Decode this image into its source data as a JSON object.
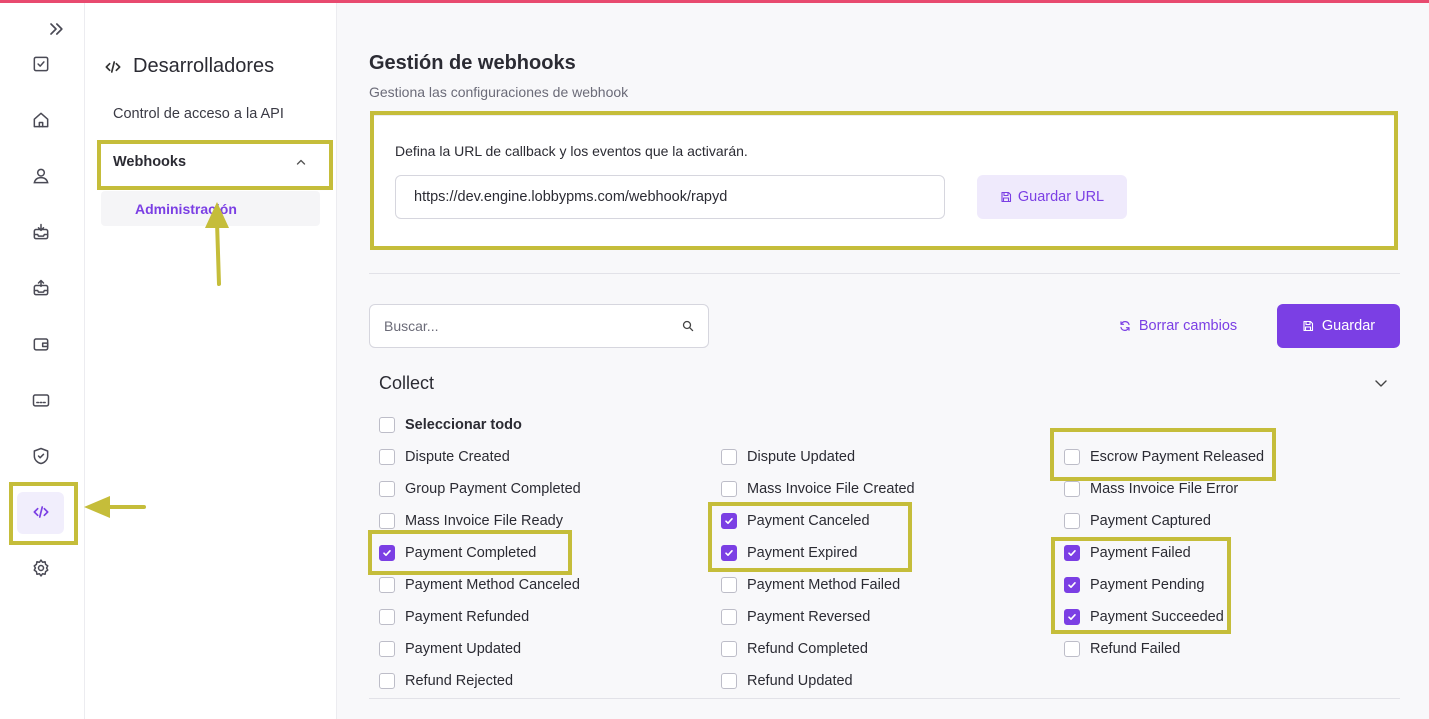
{
  "colors": {
    "accent": "#7b3fe4",
    "top_bar": "#e84a6f",
    "annotation": "#c5bd3a"
  },
  "rail": {
    "icons": [
      "chevrons-right-icon",
      "checkbox-icon",
      "home-icon",
      "user-icon",
      "inbox-in-icon",
      "inbox-out-icon",
      "wallet-icon",
      "card-icon",
      "shield-check-icon",
      "code-icon",
      "gear-icon"
    ],
    "active": "code-icon"
  },
  "subnav": {
    "title": "Desarrolladores",
    "link": "Control de acceso a la API",
    "group": "Webhooks",
    "child": "Administración"
  },
  "main": {
    "title": "Gestión de webhooks",
    "subtitle": "Gestiona las configuraciones de webhook",
    "url_card": {
      "label": "Defina la URL de callback y los eventos que la activarán.",
      "url_value": "https://dev.engine.lobbypms.com/webhook/rapyd",
      "save_url_label": "Guardar URL"
    },
    "search_placeholder": "Buscar...",
    "reset_label": "Borrar cambios",
    "save_label": "Guardar",
    "section": "Collect",
    "select_all": "Seleccionar todo",
    "events": [
      [
        {
          "label": "Dispute Created",
          "checked": false
        },
        {
          "label": "Dispute Updated",
          "checked": false
        },
        {
          "label": "Escrow Payment Released",
          "checked": false
        }
      ],
      [
        {
          "label": "Group Payment Completed",
          "checked": false
        },
        {
          "label": "Mass Invoice File Created",
          "checked": false
        },
        {
          "label": "Mass Invoice File Error",
          "checked": false
        }
      ],
      [
        {
          "label": "Mass Invoice File Ready",
          "checked": false
        },
        {
          "label": "Payment Canceled",
          "checked": true
        },
        {
          "label": "Payment Captured",
          "checked": false
        }
      ],
      [
        {
          "label": "Payment Completed",
          "checked": true
        },
        {
          "label": "Payment Expired",
          "checked": true
        },
        {
          "label": "Payment Failed",
          "checked": true
        }
      ],
      [
        {
          "label": "Payment Method Canceled",
          "checked": false
        },
        {
          "label": "Payment Method Failed",
          "checked": false
        },
        {
          "label": "Payment Pending",
          "checked": true
        }
      ],
      [
        {
          "label": "Payment Refunded",
          "checked": false
        },
        {
          "label": "Payment Reversed",
          "checked": false
        },
        {
          "label": "Payment Succeeded",
          "checked": true
        }
      ],
      [
        {
          "label": "Payment Updated",
          "checked": false
        },
        {
          "label": "Refund Completed",
          "checked": false
        },
        {
          "label": "Refund Failed",
          "checked": false
        }
      ],
      [
        {
          "label": "Refund Rejected",
          "checked": false
        },
        {
          "label": "Refund Updated",
          "checked": false
        }
      ]
    ]
  }
}
